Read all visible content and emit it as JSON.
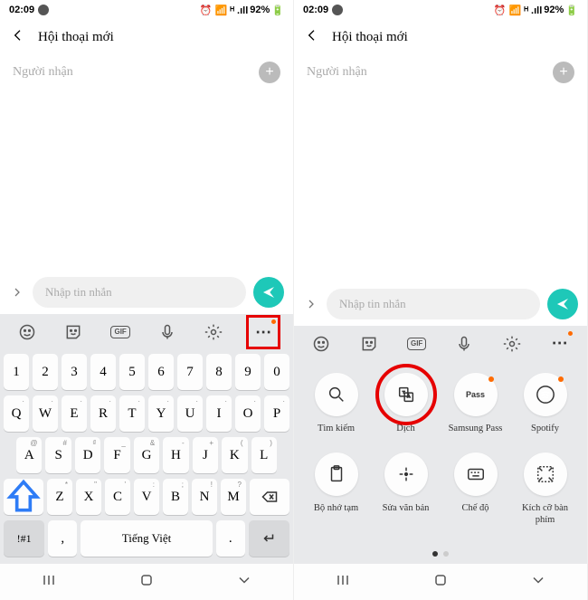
{
  "status": {
    "time": "02:09",
    "battery": "92%"
  },
  "header": {
    "title": "Hội thoại mới"
  },
  "recipient": {
    "placeholder": "Người nhận"
  },
  "compose": {
    "placeholder": "Nhập tin nhắn"
  },
  "toolbar": {
    "gif": "GIF"
  },
  "keyboard": {
    "row_num": [
      "1",
      "2",
      "3",
      "4",
      "5",
      "6",
      "7",
      "8",
      "9",
      "0"
    ],
    "row1": [
      {
        "m": "Q",
        "a": "·"
      },
      {
        "m": "W",
        "a": "·"
      },
      {
        "m": "E",
        "a": "·"
      },
      {
        "m": "R",
        "a": "·"
      },
      {
        "m": "T",
        "a": "·"
      },
      {
        "m": "Y",
        "a": "·"
      },
      {
        "m": "U",
        "a": "·"
      },
      {
        "m": "I",
        "a": "·"
      },
      {
        "m": "O",
        "a": "·"
      },
      {
        "m": "P",
        "a": "·"
      }
    ],
    "row2": [
      {
        "m": "A",
        "a": "@"
      },
      {
        "m": "S",
        "a": "#"
      },
      {
        "m": "D",
        "a": "₫"
      },
      {
        "m": "F",
        "a": "_"
      },
      {
        "m": "G",
        "a": "&"
      },
      {
        "m": "H",
        "a": "-"
      },
      {
        "m": "J",
        "a": "+"
      },
      {
        "m": "K",
        "a": "("
      },
      {
        "m": "L",
        "a": ")"
      }
    ],
    "row3": [
      {
        "m": "Z",
        "a": "*"
      },
      {
        "m": "X",
        "a": "\""
      },
      {
        "m": "C",
        "a": "'"
      },
      {
        "m": "V",
        "a": ":"
      },
      {
        "m": "B",
        "a": ";"
      },
      {
        "m": "N",
        "a": "!"
      },
      {
        "m": "M",
        "a": "?"
      }
    ],
    "sym": "!#1",
    "comma": ",",
    "space": "Tiếng Việt",
    "period": "."
  },
  "grid": {
    "row1": [
      {
        "name": "search",
        "label": "Tìm kiếm",
        "icon": "search",
        "dot": false,
        "hl": false
      },
      {
        "name": "translate",
        "label": "Dịch",
        "icon": "translate",
        "dot": false,
        "hl": true
      },
      {
        "name": "samsung-pass",
        "label": "Samsung Pass",
        "icon": "pass",
        "dot": true,
        "hl": false
      },
      {
        "name": "spotify",
        "label": "Spotify",
        "icon": "spotify",
        "dot": true,
        "hl": false
      }
    ],
    "row2": [
      {
        "name": "clipboard",
        "label": "Bộ nhớ tạm",
        "icon": "clipboard",
        "dot": false,
        "hl": false
      },
      {
        "name": "text-edit",
        "label": "Sửa văn bản",
        "icon": "textedit",
        "dot": false,
        "hl": false
      },
      {
        "name": "mode",
        "label": "Chế độ",
        "icon": "mode",
        "dot": false,
        "hl": false
      },
      {
        "name": "kb-size",
        "label": "Kích cỡ bàn phím",
        "icon": "kbsize",
        "dot": false,
        "hl": false
      }
    ]
  }
}
